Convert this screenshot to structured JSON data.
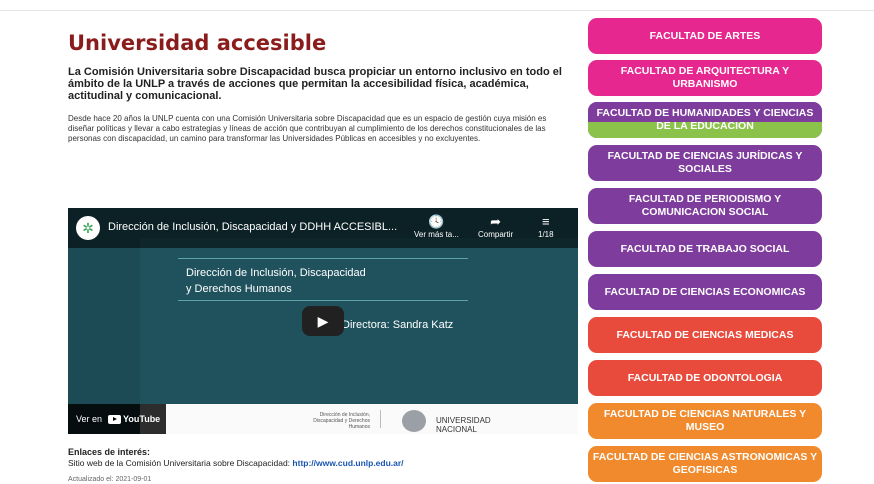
{
  "page": {
    "title": "Universidad accesible",
    "lead": "La Comisión Universitaria sobre Discapacidad busca propiciar un entorno inclusivo en todo el ámbito de la UNLP a través de acciones que permitan la accesibilidad física, académica, actitudinal y comunicacional.",
    "body": "Desde hace 20 años la UNLP cuenta con una Comisión Universitaria sobre Discapacidad que es un espacio de gestión cuya misión es diseñar políticas y llevar a cabo estrategias y líneas de acción que contribuyan al cumplimiento de los derechos constitucionales de las personas con discapacidad, un camino para transformar las Universidades Públicas en accesibles y no excluyentes."
  },
  "video": {
    "title": "Dirección de Inclusión, Discapacidad y DDHH ACCESIBL...",
    "watch_later": "Ver más ta...",
    "share": "Compartir",
    "playlist_count": "1/18",
    "slide_title_line1": "Dirección de Inclusión, Discapacidad",
    "slide_title_line2": "y Derechos Humanos",
    "director": "Directora: Sandra Katz",
    "watch_on": "Ver en",
    "youtube": "YouTube",
    "footer_small_1": "Dirección de Inclusión,",
    "footer_small_2": "Discapacidad y Derechos Humanos",
    "footer_uni_1": "UNIVERSIDAD",
    "footer_uni_2": "NACIONAL"
  },
  "links": {
    "heading": "Enlaces de interés:",
    "text": "Sitio web de la Comisión Universitaria sobre Discapacidad:",
    "url": "http://www.cud.unlp.edu.ar/"
  },
  "updated": "Actualizado el: 2021-09-01",
  "faculties": [
    {
      "label": "FACULTAD DE ARTES",
      "color": "#e6278f"
    },
    {
      "label": "FACULTAD DE ARQUITECTURA Y URBANISMO",
      "color": "#e6278f"
    },
    {
      "label": "FACULTAD DE HUMANIDADES Y CIENCIAS DE LA EDUCACION",
      "color": "#7e3c9c",
      "color2": "#8bc34a"
    },
    {
      "label": "FACULTAD DE CIENCIAS JURÍDICAS Y SOCIALES",
      "color": "#7e3c9c"
    },
    {
      "label": "FACULTAD DE PERIODISMO Y COMUNICACION SOCIAL",
      "color": "#7e3c9c"
    },
    {
      "label": "FACULTAD DE TRABAJO SOCIAL",
      "color": "#7e3c9c"
    },
    {
      "label": "FACULTAD DE CIENCIAS ECONOMICAS",
      "color": "#7e3c9c"
    },
    {
      "label": "FACULTAD DE CIENCIAS MEDICAS",
      "color": "#e84a3c"
    },
    {
      "label": "FACULTAD DE ODONTOLOGIA",
      "color": "#e84a3c"
    },
    {
      "label": "FACULTAD DE CIENCIAS NATURALES Y MUSEO",
      "color": "#f08a2c"
    },
    {
      "label": "FACULTAD DE CIENCIAS ASTRONOMICAS Y GEOFISICAS",
      "color": "#f08a2c"
    }
  ]
}
